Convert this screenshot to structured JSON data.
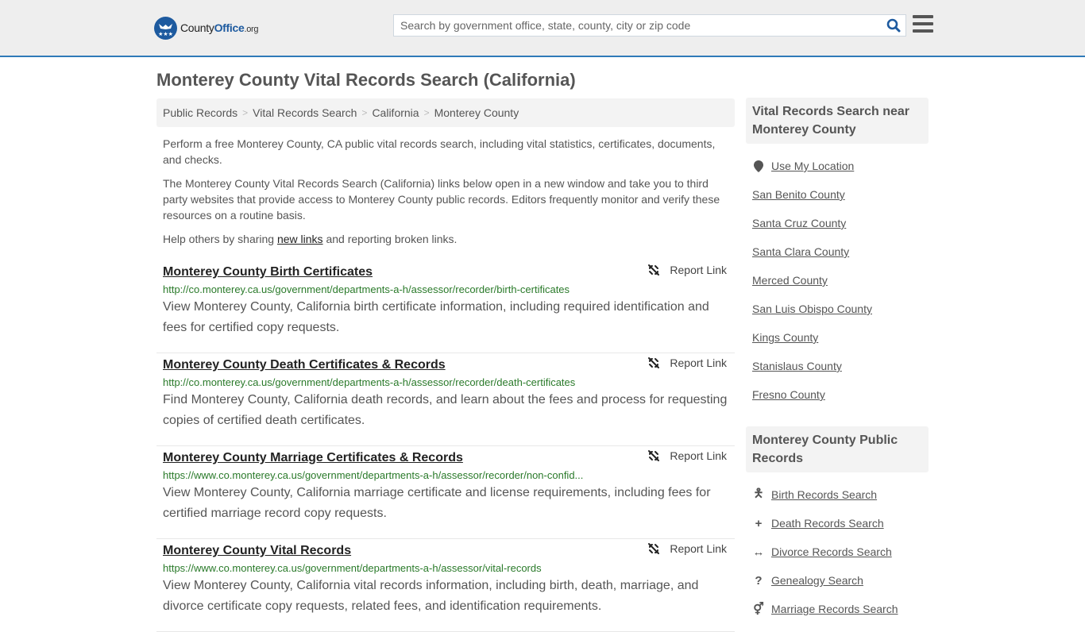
{
  "header": {
    "logo": {
      "part1": "County",
      "part2": "Office",
      "part3": ".org"
    },
    "search_placeholder": "Search by government office, state, county, city or zip code",
    "search_value": ""
  },
  "page_title": "Monterey County Vital Records Search (California)",
  "breadcrumb": [
    "Public Records",
    "Vital Records Search",
    "California",
    "Monterey County"
  ],
  "intro": {
    "p1": "Perform a free Monterey County, CA public vital records search, including vital statistics, certificates, documents, and checks.",
    "p2": "The Monterey County Vital Records Search (California) links below open in a new window and take you to third party websites that provide access to Monterey County public records. Editors frequently monitor and verify these resources on a routine basis.",
    "p3_before": "Help others by sharing ",
    "p3_link": "new links",
    "p3_after": " and reporting broken links."
  },
  "report_label": "Report Link",
  "results": [
    {
      "title": "Monterey County Birth Certificates",
      "url": "http://co.monterey.ca.us/government/departments-a-h/assessor/recorder/birth-certificates",
      "desc": "View Monterey County, California birth certificate information, including required identification and fees for certified copy requests."
    },
    {
      "title": "Monterey County Death Certificates & Records",
      "url": "http://co.monterey.ca.us/government/departments-a-h/assessor/recorder/death-certificates",
      "desc": "Find Monterey County, California death records, and learn about the fees and process for requesting copies of certified death certificates."
    },
    {
      "title": "Monterey County Marriage Certificates & Records",
      "url": "https://www.co.monterey.ca.us/government/departments-a-h/assessor/recorder/non-confid...",
      "desc": "View Monterey County, California marriage certificate and license requirements, including fees for certified marriage record copy requests."
    },
    {
      "title": "Monterey County Vital Records",
      "url": "https://www.co.monterey.ca.us/government/departments-a-h/assessor/vital-records",
      "desc": "View Monterey County, California vital records information, including birth, death, marriage, and divorce certificate copy requests, related fees, and identification requirements."
    }
  ],
  "sidebar": {
    "nearby_title": "Vital Records Search near Monterey County",
    "use_location": "Use My Location",
    "nearby": [
      "San Benito County",
      "Santa Cruz County",
      "Santa Clara County",
      "Merced County",
      "San Luis Obispo County",
      "Kings County",
      "Stanislaus County",
      "Fresno County"
    ],
    "public_title": "Monterey County Public Records",
    "public_links": [
      {
        "icon": "child-icon",
        "label": "Birth Records Search"
      },
      {
        "icon": "plus-icon",
        "label": "Death Records Search"
      },
      {
        "icon": "arrows-horizontal-icon",
        "label": "Divorce Records Search"
      },
      {
        "icon": "question-icon",
        "label": "Genealogy Search"
      },
      {
        "icon": "mars-venus-icon",
        "label": "Marriage Records Search"
      }
    ]
  }
}
